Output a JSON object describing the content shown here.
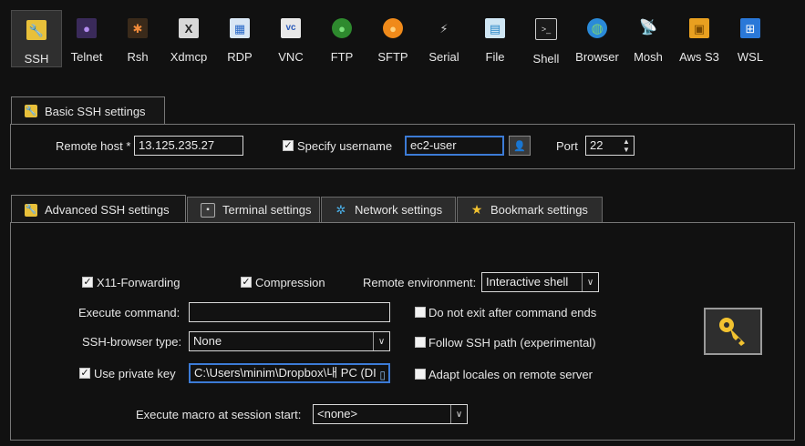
{
  "toolbar": {
    "items": [
      {
        "label": "SSH",
        "icon": "wrench-icon",
        "glyph": "🔧",
        "bg": "#e8c03a"
      },
      {
        "label": "Telnet",
        "icon": "telnet-icon",
        "glyph": "●",
        "bg": "#6a4aa0"
      },
      {
        "label": "Rsh",
        "icon": "rsh-icon",
        "glyph": "✱",
        "bg": "#c0561e"
      },
      {
        "label": "Xdmcp",
        "icon": "xdmcp-icon",
        "glyph": "X",
        "bg": "#4a4a4a"
      },
      {
        "label": "RDP",
        "icon": "rdp-icon",
        "glyph": "▦",
        "bg": "#3a74c8"
      },
      {
        "label": "VNC",
        "icon": "vnc-icon",
        "glyph": "vc",
        "bg": "#e8e8e8"
      },
      {
        "label": "FTP",
        "icon": "ftp-icon",
        "glyph": "●",
        "bg": "#3aa03a"
      },
      {
        "label": "SFTP",
        "icon": "sftp-icon",
        "glyph": "●",
        "bg": "#f08a1a"
      },
      {
        "label": "Serial",
        "icon": "serial-icon",
        "glyph": "⚡",
        "bg": "#6a6a6a"
      },
      {
        "label": "File",
        "icon": "file-icon",
        "glyph": "▤",
        "bg": "#2a88c8"
      },
      {
        "label": "Shell",
        "icon": "shell-icon",
        "glyph": ">_",
        "bg": "#2a2a2a"
      },
      {
        "label": "Browser",
        "icon": "globe-icon",
        "glyph": "◍",
        "bg": "#2a8ad8"
      },
      {
        "label": "Mosh",
        "icon": "antenna-icon",
        "glyph": "📡",
        "bg": "#2a6ab8"
      },
      {
        "label": "Aws S3",
        "icon": "aws-s3-icon",
        "glyph": "▣",
        "bg": "#e8a020"
      },
      {
        "label": "WSL",
        "icon": "windows-icon",
        "glyph": "⊞",
        "bg": "#2a78d8"
      }
    ],
    "selected": "SSH"
  },
  "basic": {
    "tab_label": "Basic SSH settings",
    "remote_host_label": "Remote host *",
    "remote_host_value": "13.125.235.27",
    "specify_username_label": "Specify username",
    "specify_username_checked": true,
    "username_value": "ec2-user",
    "port_label": "Port",
    "port_value": "22"
  },
  "advanced_tabs": [
    {
      "label": "Advanced SSH settings",
      "icon": "wrench-icon",
      "active": true
    },
    {
      "label": "Terminal settings",
      "icon": "terminal-icon",
      "active": false
    },
    {
      "label": "Network settings",
      "icon": "network-icon",
      "active": false
    },
    {
      "label": "Bookmark settings",
      "icon": "star-icon",
      "active": false
    }
  ],
  "advanced": {
    "x11_label": "X11-Forwarding",
    "x11_checked": true,
    "compression_label": "Compression",
    "compression_checked": true,
    "remote_env_label": "Remote environment:",
    "remote_env_value": "Interactive shell",
    "exec_command_label": "Execute command:",
    "exec_command_value": "",
    "no_exit_label": "Do not exit after command ends",
    "no_exit_checked": false,
    "browser_type_label": "SSH-browser type:",
    "browser_type_value": "None",
    "follow_path_label": "Follow SSH path (experimental)",
    "follow_path_checked": false,
    "private_key_label": "Use private key",
    "private_key_checked": true,
    "private_key_value": "C:\\Users\\minim\\Dropbox\\내 PC (DI",
    "adapt_locales_label": "Adapt locales on remote server",
    "adapt_locales_checked": false,
    "macro_label": "Execute macro at session start:",
    "macro_value": "<none>"
  },
  "colors": {
    "accent_focus": "#3c7bd6",
    "key_icon": "#f2c230",
    "background": "#111111"
  }
}
